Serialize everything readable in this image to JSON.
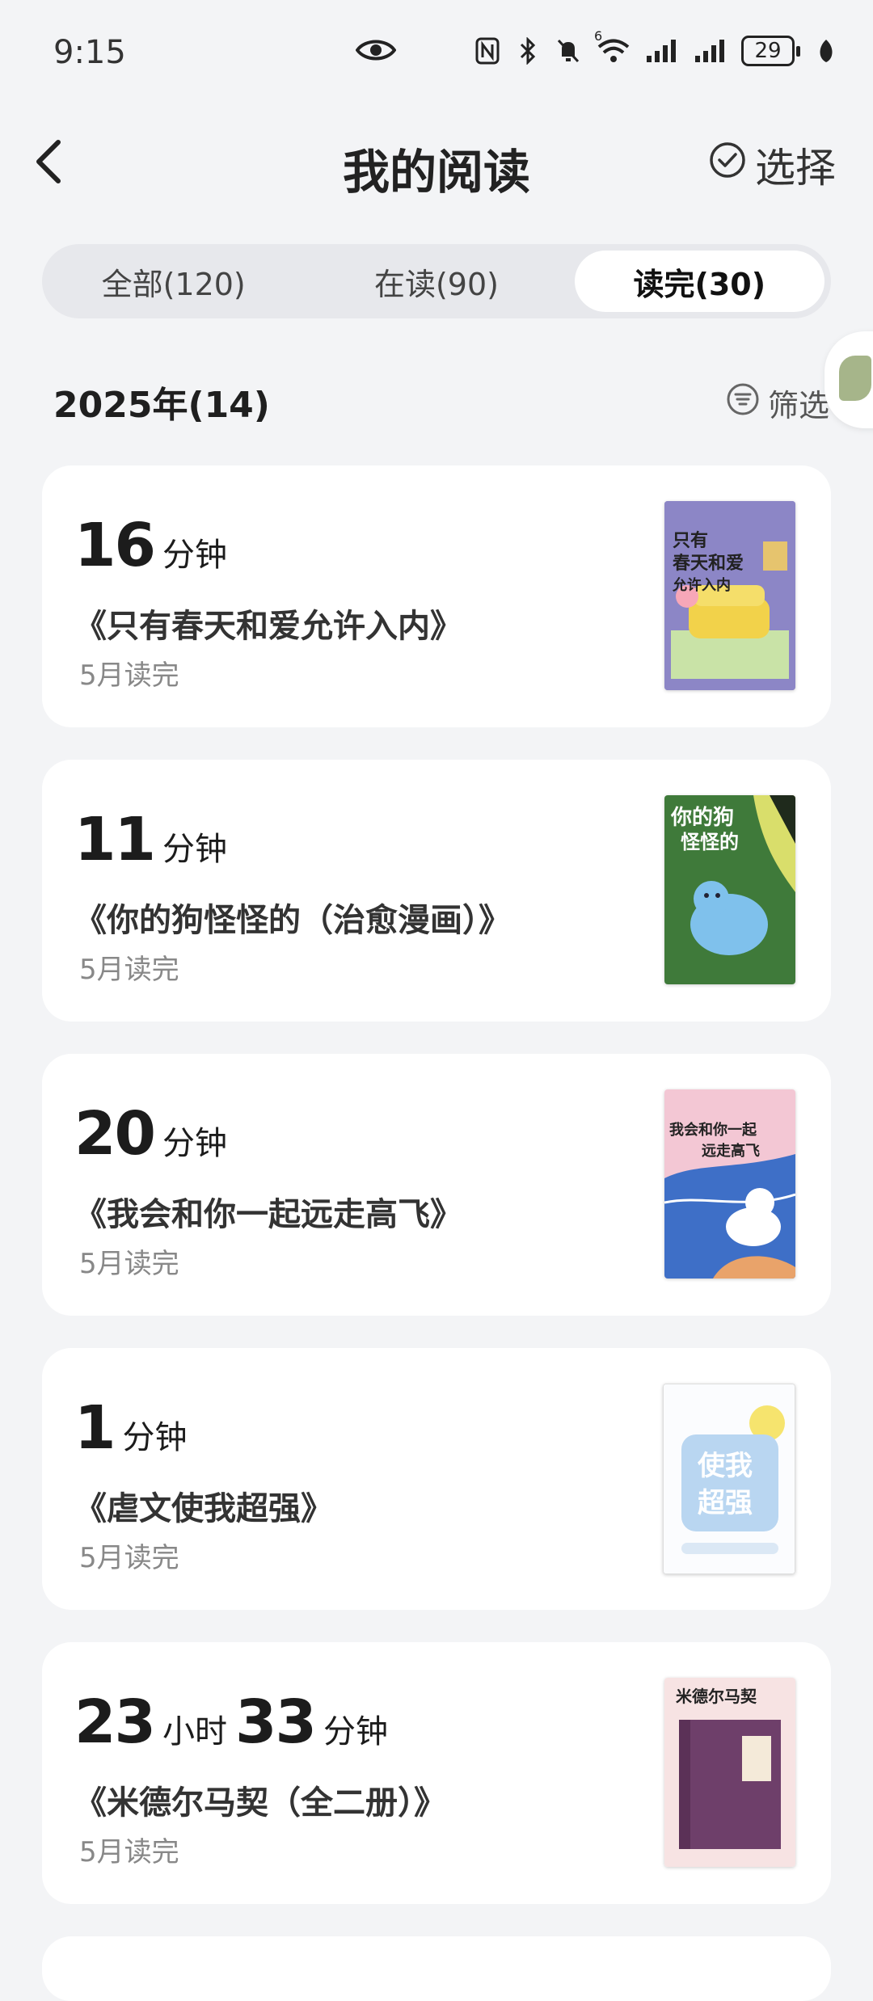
{
  "status_bar": {
    "time": "9:15",
    "battery": "29",
    "icons": [
      "eye-icon",
      "nfc-icon",
      "bluetooth-icon",
      "mute-icon",
      "wifi-icon",
      "signal-icon",
      "signal-icon",
      "battery-icon",
      "leaf-icon"
    ],
    "wifi_badge": "6"
  },
  "header": {
    "title": "我的阅读",
    "select_label": "选择"
  },
  "tabs": [
    {
      "label": "全部(120)",
      "active": false
    },
    {
      "label": "在读(90)",
      "active": false
    },
    {
      "label": "读完(30)",
      "active": true
    }
  ],
  "section": {
    "year_label": "2025年(14)",
    "filter_label": "筛选"
  },
  "cards": [
    {
      "parts": [
        {
          "num": "16",
          "unit": "分钟"
        }
      ],
      "title": "《只有春天和爱允许入内》",
      "status": "5月读完",
      "cover_text": "只有春天和爱允许入内"
    },
    {
      "parts": [
        {
          "num": "11",
          "unit": "分钟"
        }
      ],
      "title": "《你的狗怪怪的（治愈漫画）》",
      "status": "5月读完",
      "cover_text": "你的狗怪怪的"
    },
    {
      "parts": [
        {
          "num": "20",
          "unit": "分钟"
        }
      ],
      "title": "《我会和你一起远走高飞》",
      "status": "5月读完",
      "cover_text": "我会和你一起远走高飞"
    },
    {
      "parts": [
        {
          "num": "1",
          "unit": "分钟"
        }
      ],
      "title": "《虐文使我超强》",
      "status": "5月读完",
      "cover_text": "使我超强"
    },
    {
      "parts": [
        {
          "num": "23",
          "unit": "小时"
        },
        {
          "num": "33",
          "unit": "分钟"
        }
      ],
      "title": "《米德尔马契（全二册）》",
      "status": "5月读完",
      "cover_text": "米德尔马契"
    }
  ],
  "colors": {
    "background": "#f3f4f6",
    "card": "#ffffff",
    "tab_track": "#e7e8ec"
  }
}
